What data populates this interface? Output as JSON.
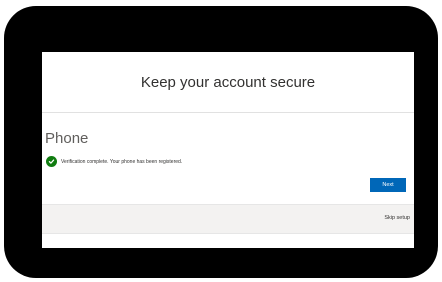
{
  "header": {
    "title": "Keep your account secure"
  },
  "section": {
    "title": "Phone",
    "status_icon": "check-circle-icon",
    "status_text": "Verification complete. Your phone has been registered.",
    "status_color": "#107c10"
  },
  "actions": {
    "next_label": "Next",
    "next_color": "#0067b8"
  },
  "footer": {
    "skip_label": "Skip setup"
  }
}
